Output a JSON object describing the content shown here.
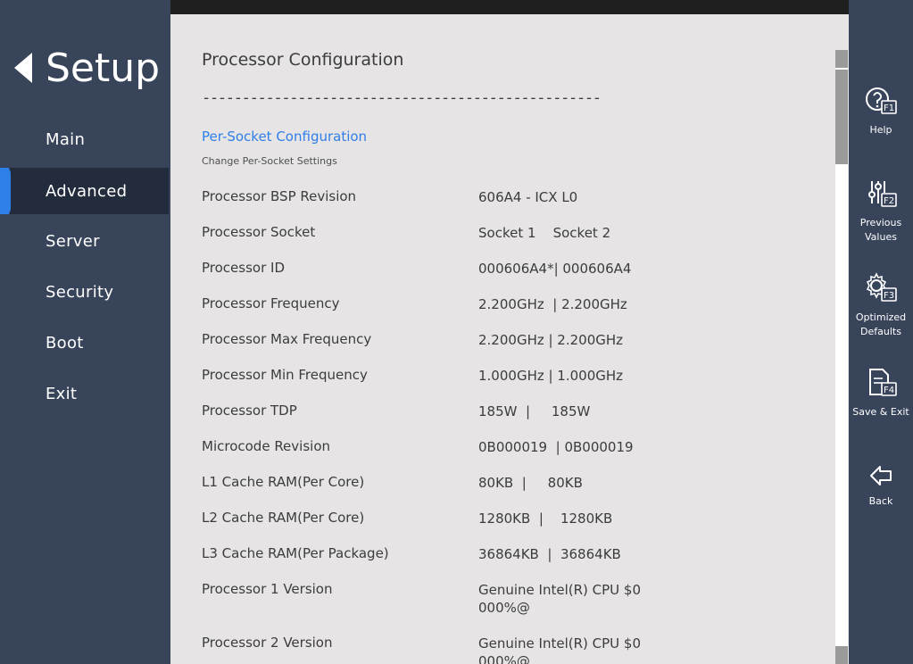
{
  "sidebar": {
    "title": "Setup",
    "items": [
      {
        "label": "Main",
        "active": false
      },
      {
        "label": "Advanced",
        "active": true
      },
      {
        "label": "Server",
        "active": false
      },
      {
        "label": "Security",
        "active": false
      },
      {
        "label": "Boot",
        "active": false
      },
      {
        "label": "Exit",
        "active": false
      }
    ]
  },
  "content": {
    "title": "Processor Configuration",
    "divider": "--------------------------------------------------",
    "link": "Per-Socket Configuration",
    "link_help": "Change Per-Socket Settings",
    "rows": [
      {
        "label": "Processor BSP Revision",
        "value": "606A4 - ICX L0"
      },
      {
        "label": "Processor Socket",
        "value": "Socket 1    Socket 2"
      },
      {
        "label": "Processor ID",
        "value": "000606A4*| 000606A4"
      },
      {
        "label": "Processor Frequency",
        "value": "2.200GHz  | 2.200GHz"
      },
      {
        "label": "Processor Max Frequency",
        "value": "2.200GHz | 2.200GHz"
      },
      {
        "label": "Processor Min Frequency",
        "value": "1.000GHz | 1.000GHz"
      },
      {
        "label": "Processor TDP",
        "value": "185W  |     185W"
      },
      {
        "label": "Microcode Revision",
        "value": "0B000019  | 0B000019"
      },
      {
        "label": "L1 Cache RAM(Per Core)",
        "value": "80KB  |     80KB"
      },
      {
        "label": "L2 Cache RAM(Per Core)",
        "value": "1280KB  |    1280KB"
      },
      {
        "label": "L3 Cache RAM(Per Package)",
        "value": "36864KB  |  36864KB"
      },
      {
        "label": "Processor 1 Version",
        "value": "Genuine Intel(R) CPU $0 000%@"
      },
      {
        "label": "Processor 2 Version",
        "value": "Genuine Intel(R) CPU $0 000%@"
      }
    ]
  },
  "toolbar": {
    "help": {
      "label": "Help",
      "key": "F1",
      "icon": "help-icon"
    },
    "previous": {
      "label": "Previous Values",
      "key": "F2",
      "icon": "sliders-icon"
    },
    "optimized": {
      "label": "Optimized Defaults",
      "key": "F3",
      "icon": "gear-icon"
    },
    "save_exit": {
      "label": "Save & Exit",
      "key": "F4",
      "icon": "save-document-icon"
    },
    "back": {
      "label": "Back",
      "icon": "back-arrow-icon"
    }
  },
  "colors": {
    "sidebar_bg": "#38445a",
    "active_bg": "#232c3d",
    "active_marker": "#2f7fe8",
    "content_bg": "#e6e4e5",
    "link": "#2f7fe8"
  }
}
